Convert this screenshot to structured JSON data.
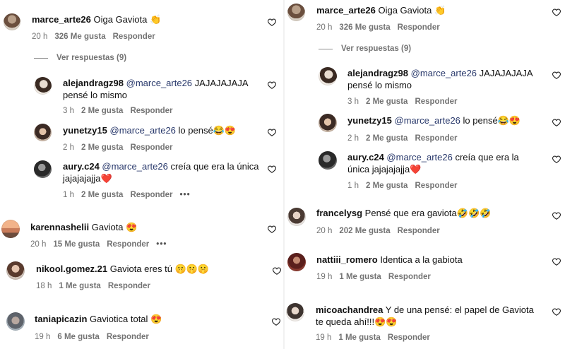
{
  "left": {
    "comments": [
      {
        "user": "marce_arte26",
        "mention": "",
        "text": "Oiga Gaviota 👏",
        "time": "20 h",
        "likes": "326 Me gusta",
        "reply": "Responder",
        "more": ""
      },
      {
        "user": "alejandragz98",
        "mention": "@marce_arte26",
        "text": "JAJAJAJAJA pensé lo mismo",
        "time": "3 h",
        "likes": "2 Me gusta",
        "reply": "Responder",
        "more": ""
      },
      {
        "user": "yunetzy15",
        "mention": "@marce_arte26",
        "text": "lo pensé😂😍",
        "time": "2 h",
        "likes": "2 Me gusta",
        "reply": "Responder",
        "more": ""
      },
      {
        "user": "aury.c24",
        "mention": "@marce_arte26",
        "text": "creía que era la única jajajajajja❤️",
        "time": "1 h",
        "likes": "2 Me gusta",
        "reply": "Responder",
        "more": "•••"
      },
      {
        "user": "karennashelii",
        "mention": "",
        "text": "Gaviota 😍",
        "time": "20 h",
        "likes": "15 Me gusta",
        "reply": "Responder",
        "more": "•••"
      },
      {
        "user": "nikool.gomez.21",
        "mention": "",
        "text": "Gaviota eres tú 🤫🤫🤫",
        "time": "18 h",
        "likes": "1 Me gusta",
        "reply": "Responder",
        "more": ""
      },
      {
        "user": "taniapicazin",
        "mention": "",
        "text": "Gaviotica total 😍",
        "time": "19 h",
        "likes": "6 Me gusta",
        "reply": "Responder",
        "more": ""
      }
    ],
    "view_replies": "Ver respuestas (9)"
  },
  "right": {
    "comments": [
      {
        "user": "marce_arte26",
        "mention": "",
        "text": "Oiga Gaviota 👏",
        "time": "20 h",
        "likes": "326 Me gusta",
        "reply": "Responder",
        "more": ""
      },
      {
        "user": "alejandragz98",
        "mention": "@marce_arte26",
        "text": "JAJAJAJAJA pensé lo mismo",
        "time": "3 h",
        "likes": "2 Me gusta",
        "reply": "Responder",
        "more": ""
      },
      {
        "user": "yunetzy15",
        "mention": "@marce_arte26",
        "text": "lo pensé😂😍",
        "time": "2 h",
        "likes": "2 Me gusta",
        "reply": "Responder",
        "more": ""
      },
      {
        "user": "aury.c24",
        "mention": "@marce_arte26",
        "text": "creía que era la única jajajajajja❤️",
        "time": "1 h",
        "likes": "2 Me gusta",
        "reply": "Responder",
        "more": ""
      },
      {
        "user": "francelysg",
        "mention": "",
        "text": "Pensé que era gaviota🤣🤣🤣",
        "time": "20 h",
        "likes": "202 Me gusta",
        "reply": "Responder",
        "more": ""
      },
      {
        "user": "nattiii_romero",
        "mention": "",
        "text": "Identica a la gabiota",
        "time": "19 h",
        "likes": "1 Me gusta",
        "reply": "Responder",
        "more": ""
      },
      {
        "user": "micoachandrea",
        "mention": "",
        "text": "Y de una pensé: el papel de Gaviota te queda ahí!!!😍😍",
        "time": "19 h",
        "likes": "1 Me gusta",
        "reply": "Responder",
        "more": ""
      }
    ],
    "view_replies": "Ver respuestas (9)"
  },
  "icons": {
    "like": "heart-outline-icon",
    "more": "more-options-icon"
  },
  "colors": {
    "meta": "#737373",
    "mention": "#28386b",
    "text": "#111111"
  }
}
